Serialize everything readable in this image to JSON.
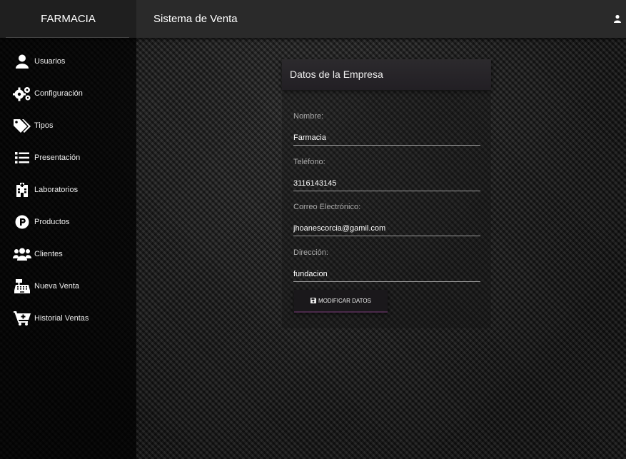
{
  "header": {
    "brand": "FARMACIA",
    "title": "Sistema de Venta",
    "user_icon": "user-icon"
  },
  "sidebar": {
    "items": [
      {
        "label": "Usuarios",
        "icon": "user-icon"
      },
      {
        "label": "Configuración",
        "icon": "gears-icon"
      },
      {
        "label": "Tipos",
        "icon": "tags-icon"
      },
      {
        "label": "Presentación",
        "icon": "list-icon"
      },
      {
        "label": "Laboratorios",
        "icon": "hospital-icon"
      },
      {
        "label": "Productos",
        "icon": "parking-icon"
      },
      {
        "label": "Clientes",
        "icon": "users-icon"
      },
      {
        "label": "Nueva Venta",
        "icon": "cash-register-icon"
      },
      {
        "label": "Historial Ventas",
        "icon": "cart-plus-icon"
      }
    ]
  },
  "company_form": {
    "title": "Datos de la Empresa",
    "nombre_label": "Nombre:",
    "nombre_value": "Farmacia",
    "telefono_label": "Teléfono:",
    "telefono_value": "3116143145",
    "correo_label": "Correo Electrónico:",
    "correo_value": "jhoanescorcia@gamil.com",
    "direccion_label": "Dirección:",
    "direccion_value": "fundacion",
    "submit_label": "MODIFICAR DATOS",
    "submit_icon": "save-icon"
  },
  "colors": {
    "topbar": "#2a2a2a",
    "sidebar": "#0b0b0b",
    "accent_underline": "#4a2a4a"
  }
}
